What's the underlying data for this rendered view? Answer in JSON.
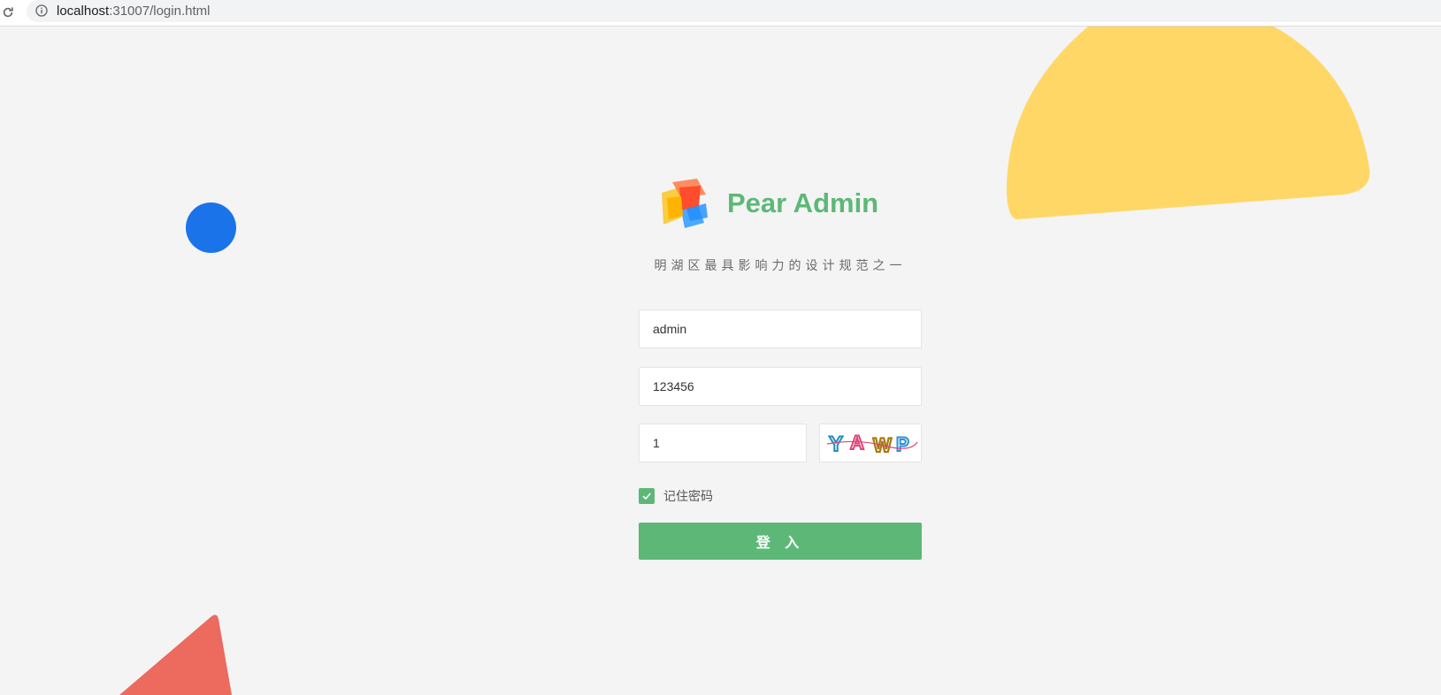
{
  "browser": {
    "url_host": "localhost",
    "url_rest": ":31007/login.html",
    "reload_icon": "reload-icon",
    "info_icon": "info-icon"
  },
  "login": {
    "brand_title": "Pear Admin",
    "subtitle": "明湖区最具影响力的设计规范之一",
    "username_value": "admin",
    "password_value": "123456",
    "captcha_value": "1",
    "captcha_text": "YAWP",
    "remember_label": "记住密码",
    "remember_checked": true,
    "login_button_label": "登 入"
  },
  "colors": {
    "brand_green": "#5db878",
    "background": "#f4f4f4",
    "deco_yellow": "#fed766",
    "deco_blue": "#1a73e8",
    "deco_red": "#ec6a5e"
  }
}
